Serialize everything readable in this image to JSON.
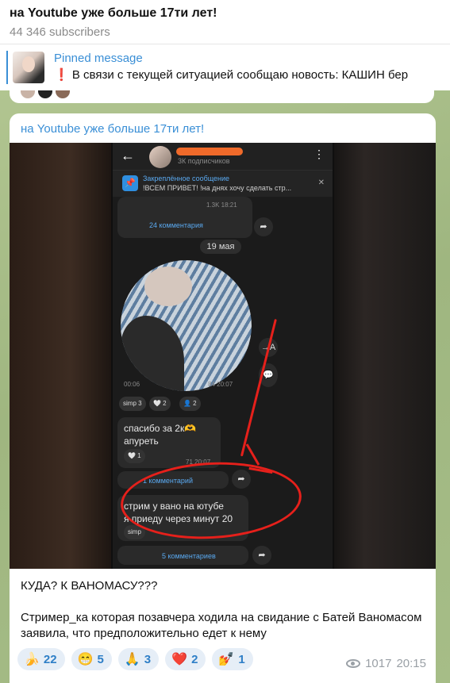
{
  "header": {
    "title": "на Youtube уже больше 17ти лет!",
    "subscribers": "44 346 subscribers"
  },
  "pinned": {
    "label": "Pinned message",
    "text": "В связи с текущей ситуацией сообщаю новость:  КАШИН бер"
  },
  "post": {
    "channel_name": "на Youtube уже больше 17ти лет!",
    "caption_line1": "КУДА? К ВАНОМАСУ???",
    "caption_line2": "Стример_ка которая позавчера ходила на свидание с Батей Ваномасом заявила, что предположительно едет к нему",
    "reactions": [
      {
        "emoji": "🍌",
        "count": "22"
      },
      {
        "emoji": "😁",
        "count": "5"
      },
      {
        "emoji": "🙏",
        "count": "3"
      },
      {
        "emoji": "❤️",
        "count": "2"
      },
      {
        "emoji": "💅",
        "count": "1"
      }
    ],
    "views": "1017",
    "time": "20:15"
  },
  "screenshot": {
    "subtitle": "3К подписчиков",
    "pinned_title": "Закреплённое сообщение",
    "pinned_text": "!ВСЕМ ПРИВЕТ! !на днях хочу сделать стр...",
    "msg1_meta": "1.3K  18:21",
    "comments1": "24 комментария",
    "date": "19 мая",
    "video_time": "00:06",
    "video_meta": "84  20:07",
    "bubble1_line1": "спасибо за 2к🫶",
    "bubble1_line2": "апуреть",
    "bubble1_meta": "71  20:07",
    "comments2": "1 комментарий",
    "bubble2_line1": "стрим  у вано на ютубе",
    "bubble2_line2": "я приеду через минут 20",
    "comments3": "5 комментариев"
  }
}
